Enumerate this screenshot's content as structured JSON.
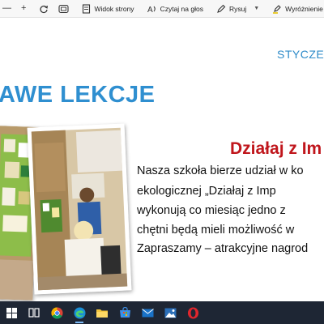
{
  "toolbar": {
    "minus": "—",
    "plus": "+",
    "page_view_label": "Widok strony",
    "read_aloud_label": "Czytaj na głos",
    "draw_label": "Rysuj",
    "highlight_label": "Wyróżnienie"
  },
  "document": {
    "month": "STYCZE",
    "heading": "AWE LEKCJE",
    "subheading": "Działaj z Im",
    "paragraph_lines": [
      "Nasza szkoła bierze udział w ko",
      "ekologicznej „Działaj z Imp",
      "wykonują co miesiąc jedno z",
      "chętni będą mieli możliwość w",
      "Zapraszamy – atrakcyjne nagrod"
    ]
  },
  "colors": {
    "heading": "#2f8fd0",
    "subheading": "#c0161c",
    "month": "#2e8bc9",
    "taskbar": "#1e2634"
  },
  "taskbar": {
    "icons": [
      "windows-start-icon",
      "task-view-icon",
      "chrome-icon",
      "edge-icon",
      "file-explorer-icon",
      "microsoft-store-icon",
      "mail-icon",
      "photos-icon",
      "opera-icon"
    ]
  }
}
